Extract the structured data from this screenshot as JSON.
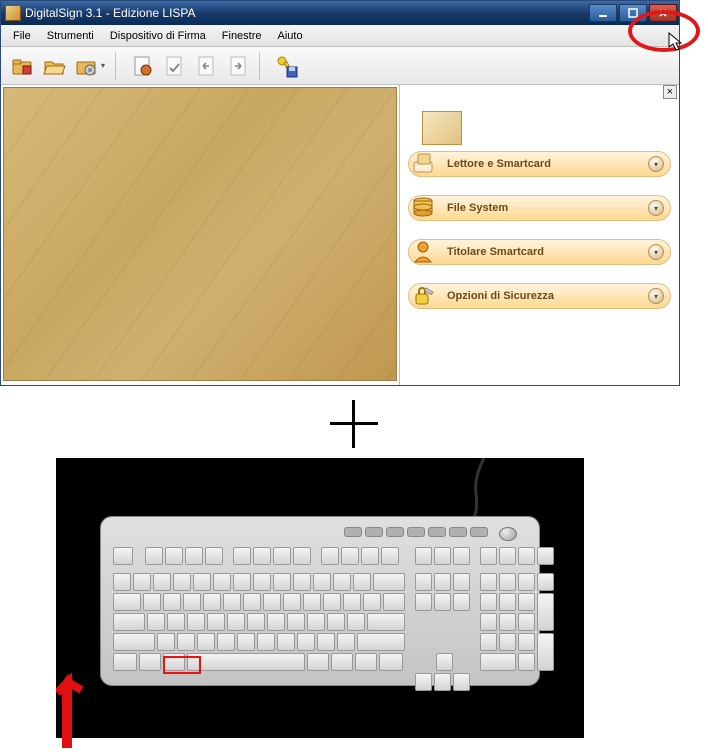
{
  "window": {
    "title": "DigitalSign 3.1 - Edizione LISPA"
  },
  "menu": {
    "items": [
      "File",
      "Strumenti",
      "Dispositivo di Firma",
      "Finestre",
      "Aiuto"
    ]
  },
  "toolbar_icons": [
    "folder-locked-icon",
    "folder-open-icon",
    "folder-gear-icon",
    "document-seal-icon",
    "document-check-icon",
    "document-back-icon",
    "document-send-icon",
    "key-save-icon"
  ],
  "sidepanel": {
    "close": "×",
    "sections": [
      {
        "label": "Lettore e Smartcard",
        "icon": "smartcard-reader-icon"
      },
      {
        "label": "File System",
        "icon": "database-disks-icon"
      },
      {
        "label": "Titolare Smartcard",
        "icon": "user-icon"
      },
      {
        "label": "Opzioni di Sicurezza",
        "icon": "lock-key-icon"
      }
    ]
  }
}
